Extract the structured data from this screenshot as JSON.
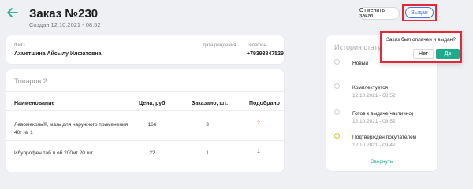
{
  "header": {
    "title": "Заказ №230",
    "created": "Создан 12.10.2021 - 08:52",
    "cancel_label": "Отменить заказ",
    "issued_label": "Выдан"
  },
  "person": {
    "name_label": "ФИО",
    "name_value": "Ахметшина Айсылу Илфатовна",
    "birth_label": "Дата рождения",
    "phone_label": "Телефон",
    "phone_value": "+79393847529"
  },
  "goods": {
    "title": "Товаров 2",
    "columns": [
      "Наименование",
      "Цена, руб.",
      "Заказано, шт.",
      "Подобрано"
    ],
    "rows": [
      {
        "name_line1": "Левомеколь®, мазь для наружного применения",
        "name_line2": "40г № 1",
        "price": "166",
        "ordered": "3",
        "picked": "2"
      },
      {
        "name_line1": "Ибупрофен таб.п.об 200мг 20 шт",
        "name_line2": "",
        "price": "22",
        "ordered": "1",
        "picked": "1"
      }
    ]
  },
  "status": {
    "title": "История статусов",
    "items": [
      {
        "name": "Новый",
        "date": ""
      },
      {
        "name": "Комплектуется",
        "date": "12.10.2021 - 08:52"
      },
      {
        "name": "Готов к выдаче(частично)",
        "date": "12.10.2021 - 08:52"
      },
      {
        "name": "Подтвержден покупателем",
        "date": "12.10.2021 - 09:42"
      }
    ],
    "collapse_label": "Свернуть"
  },
  "popup": {
    "question": "Заказ был оплачен и выдан?",
    "no_label": "Нет",
    "yes_label": "Да"
  },
  "colors": {
    "accent": "#1eaa8c",
    "highlight": "#e02a3a",
    "link_blue": "#4a7bd6"
  }
}
